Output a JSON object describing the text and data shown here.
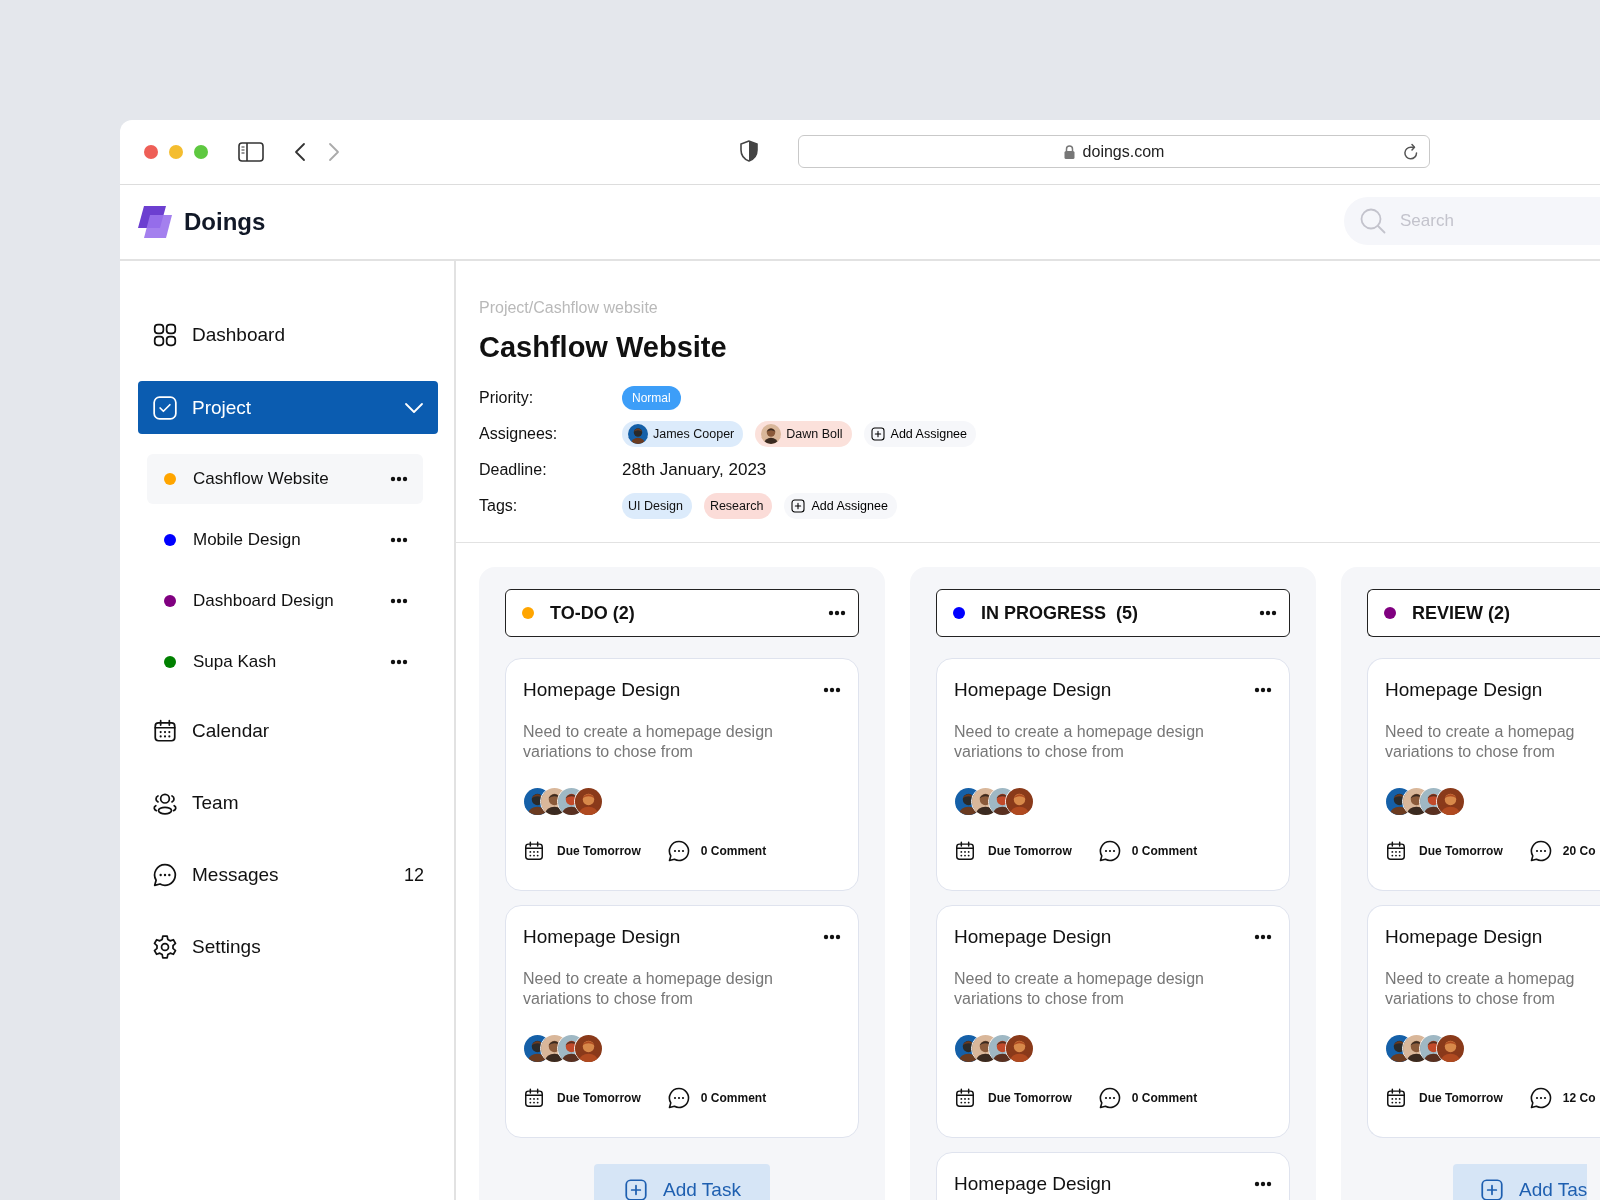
{
  "browser": {
    "url": "doings.com",
    "back_disabled": false,
    "forward_disabled": true
  },
  "app": {
    "name": "Doings",
    "search": {
      "placeholder": "Search"
    }
  },
  "sidebar": {
    "items": [
      {
        "label": "Dashboard",
        "selected": false
      },
      {
        "label": "Project",
        "selected": true,
        "expanded": true,
        "children": [
          {
            "label": "Cashflow Website",
            "color": "#ffa500",
            "selected": true
          },
          {
            "label": "Mobile Design",
            "color": "#0000ff",
            "selected": false
          },
          {
            "label": "Dashboard Design",
            "color": "#800080",
            "selected": false
          },
          {
            "label": "Supa Kash",
            "color": "#008000",
            "selected": false
          }
        ]
      },
      {
        "label": "Calendar",
        "selected": false
      },
      {
        "label": "Team",
        "selected": false
      },
      {
        "label": "Messages",
        "selected": false,
        "badge": "12"
      },
      {
        "label": "Settings",
        "selected": false
      }
    ]
  },
  "project": {
    "breadcrumb": "Project/Cashflow website",
    "title": "Cashflow Website",
    "fields": [
      {
        "kind": "priority",
        "label": "Priority:",
        "value": "Normal"
      },
      {
        "kind": "chips",
        "label": "Assignees:",
        "chips": [
          {
            "name": "James Cooper",
            "color": "#dcebfb"
          },
          {
            "name": "Dawn Boll",
            "color": "#fbe1db"
          }
        ],
        "add": "Add Assignee"
      },
      {
        "kind": "text",
        "label": "Deadline:",
        "value": "28th January, 2023"
      },
      {
        "kind": "chips",
        "label": "Tags:",
        "chips": [
          {
            "name": "UI Design",
            "color": "#dcebfb"
          },
          {
            "name": "Research",
            "color": "#fbdcd8"
          }
        ],
        "add": "Add Assignee"
      }
    ]
  },
  "board": {
    "columns": [
      {
        "title": "TO-DO (2)",
        "color": "#ffa500",
        "menu": true,
        "add_button": "Add Task",
        "cards": [
          {
            "title": "Homepage Design",
            "menu": true,
            "description": "Need to create a homepage design\nvariations to chose from",
            "due": "Due Tomorrow",
            "comments": "0 Comment"
          },
          {
            "title": "Homepage Design",
            "menu": true,
            "description": "Need to create a homepage design\nvariations to chose from",
            "due": "Due Tomorrow",
            "comments": "0 Comment"
          }
        ]
      },
      {
        "title": "IN PROGRESS  (5)",
        "color": "#0000ff",
        "menu": true,
        "cards": [
          {
            "title": "Homepage Design",
            "menu": true,
            "description": "Need to create a homepage design\nvariations to chose from",
            "due": "Due Tomorrow",
            "comments": "0 Comment"
          },
          {
            "title": "Homepage Design",
            "menu": true,
            "description": "Need to create a homepage design\nvariations to chose from",
            "due": "Due Tomorrow",
            "comments": "0 Comment"
          },
          {
            "title": "Homepage Design",
            "menu": true
          }
        ]
      },
      {
        "title": "REVIEW (2)",
        "color": "#800080",
        "add_button": "Add Tas",
        "cards": [
          {
            "title": "Homepage Design",
            "description": "Need to create a homepag\nvariations to chose from",
            "due": "Due Tomorrow",
            "comments": "20 Co"
          },
          {
            "title": "Homepage Design",
            "description": "Need to create a homepag\nvariations to chose from",
            "due": "Due Tomorrow",
            "comments": "12 Co"
          }
        ]
      }
    ]
  }
}
